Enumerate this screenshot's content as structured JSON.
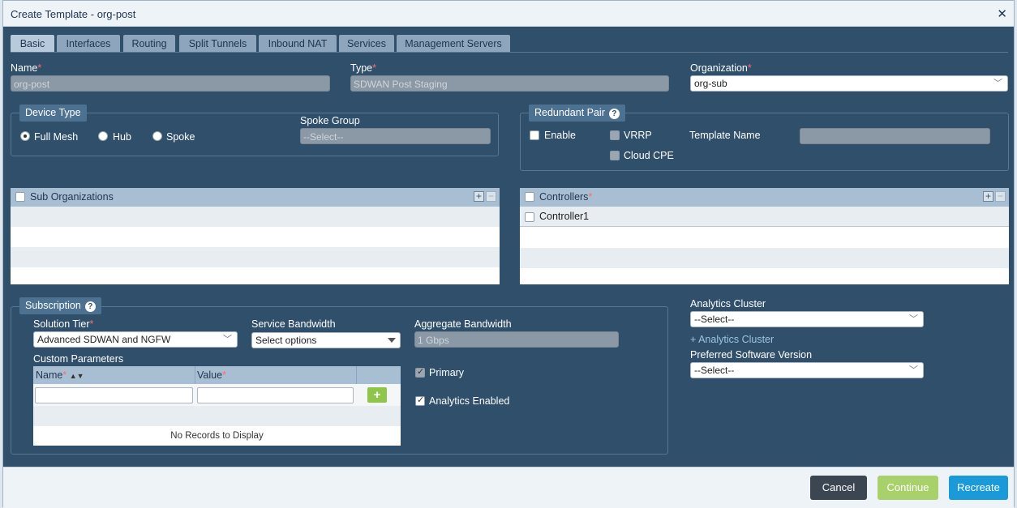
{
  "dialog": {
    "title": "Create Template - org-post",
    "close_glyph": "✕"
  },
  "tabs": [
    {
      "label": "Basic",
      "active": true
    },
    {
      "label": "Interfaces"
    },
    {
      "label": "Routing"
    },
    {
      "label": "Split Tunnels"
    },
    {
      "label": "Inbound NAT"
    },
    {
      "label": "Services"
    },
    {
      "label": "Management Servers"
    }
  ],
  "basic": {
    "name_label": "Name",
    "name_value": "org-post",
    "type_label": "Type",
    "type_value": "SDWAN Post Staging",
    "org_label": "Organization",
    "org_value": "org-sub",
    "required_mark": "*"
  },
  "device_type": {
    "legend": "Device Type",
    "options": [
      "Full Mesh",
      "Hub",
      "Spoke"
    ],
    "selected": "Full Mesh",
    "spoke_group_label": "Spoke Group",
    "spoke_group_value": "--Select--"
  },
  "redundant_pair": {
    "legend": "Redundant Pair",
    "help": "?",
    "enable_label": "Enable",
    "vrrp_label": "VRRP",
    "cloud_cpe_label": "Cloud CPE",
    "template_name_label": "Template Name"
  },
  "sub_orgs": {
    "header": "Sub Organizations"
  },
  "controllers": {
    "header": "Controllers",
    "rows": [
      "Controller1"
    ]
  },
  "subscription": {
    "legend": "Subscription",
    "help": "?",
    "solution_tier_label": "Solution Tier",
    "solution_tier_value": "Advanced SDWAN and NGFW",
    "service_bw_label": "Service Bandwidth",
    "service_bw_value": "Select options",
    "aggregate_bw_label": "Aggregate Bandwidth",
    "aggregate_bw_value": "1 Gbps",
    "custom_params_label": "Custom Parameters",
    "cp_name_header": "Name",
    "cp_value_header": "Value",
    "add_glyph": "+",
    "no_records": "No Records to Display",
    "primary_label": "Primary",
    "analytics_enabled_label": "Analytics Enabled"
  },
  "analytics": {
    "cluster_label": "Analytics Cluster",
    "cluster_value": "--Select--",
    "add_cluster_link": "+ Analytics Cluster",
    "software_label": "Preferred Software Version",
    "software_value": "--Select--"
  },
  "footer": {
    "cancel": "Cancel",
    "continue": "Continue",
    "recreate": "Recreate"
  },
  "colors": {
    "cancel": "#3b4652",
    "continue": "#a9d16b",
    "recreate": "#1a9ad9"
  }
}
